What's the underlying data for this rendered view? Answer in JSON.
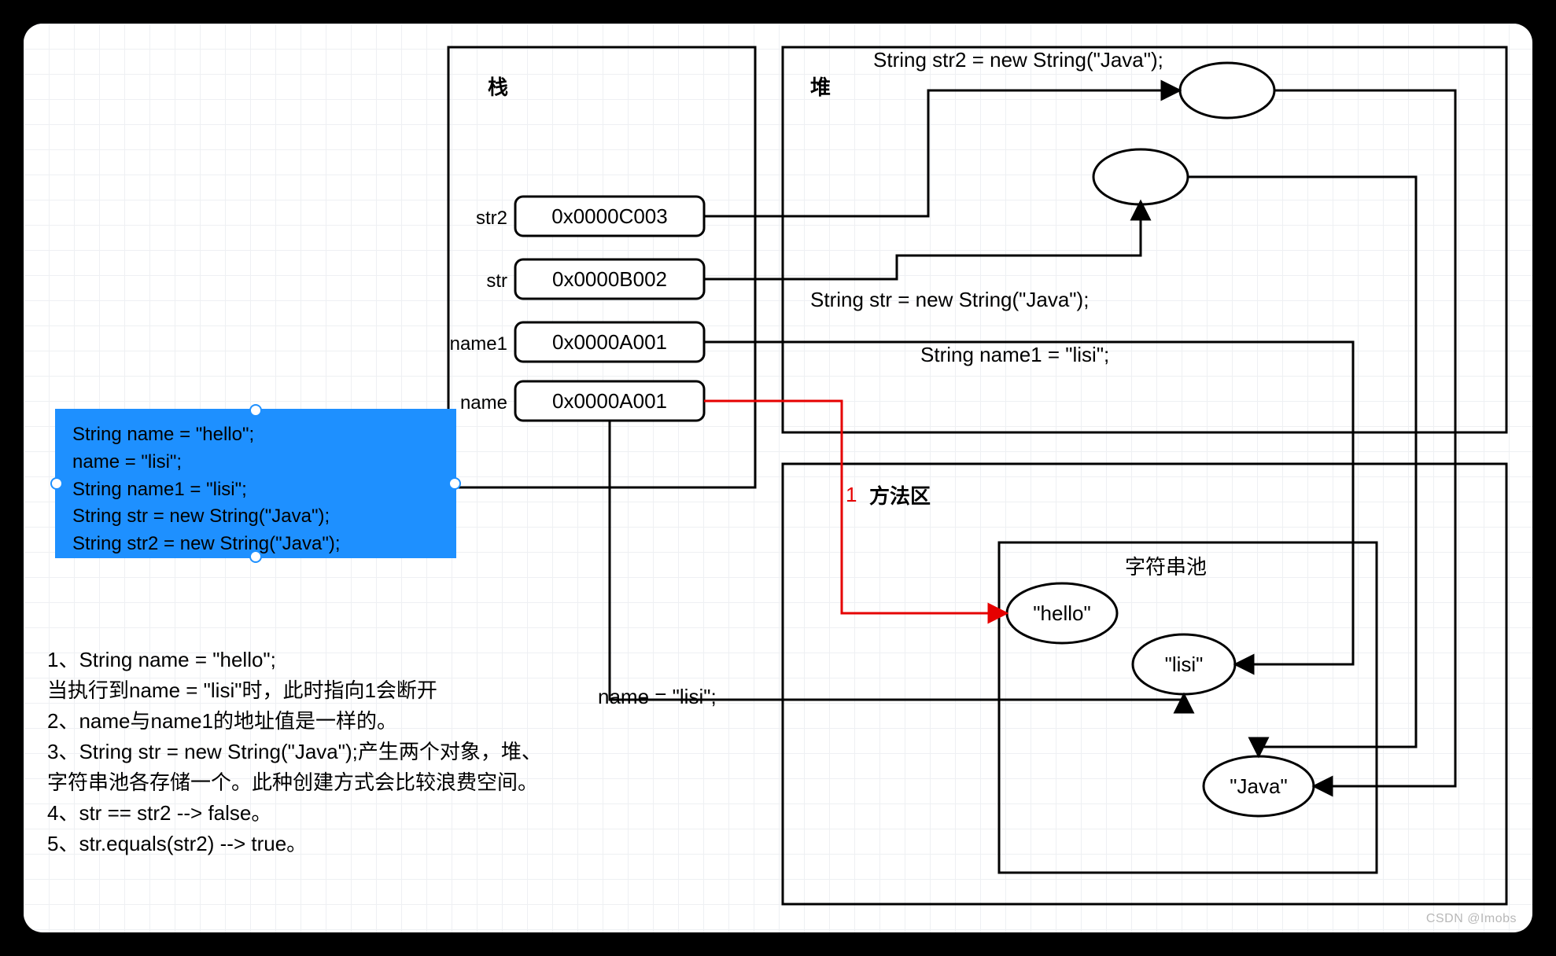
{
  "watermark": "CSDN @Imobs",
  "stack": {
    "title": "栈",
    "vars": [
      {
        "name": "str2",
        "addr": "0x0000C003"
      },
      {
        "name": "str",
        "addr": "0x0000B002"
      },
      {
        "name": "name1",
        "addr": "0x0000A001"
      },
      {
        "name": "name",
        "addr": "0x0000A001"
      }
    ]
  },
  "heap": {
    "title": "堆",
    "annotations": {
      "str2_decl": "String str2 = new String(\"Java\");",
      "str_decl": "String str = new String(\"Java\");",
      "name1_decl": "String name1 = \"lisi\";"
    }
  },
  "method_area": {
    "title": "方法区",
    "pool_title": "字符串池",
    "redline_label": "1",
    "name_assign": "name = \"lisi\";",
    "pool": {
      "hello": "\"hello\"",
      "lisi": "\"lisi\"",
      "java": "\"Java\""
    }
  },
  "code": {
    "l1": "String name = \"hello\";",
    "l2": "name = \"lisi\";",
    "l3": "String name1 = \"lisi\";",
    "l4": "String str = new String(\"Java\");",
    "l5": "String str2 = new String(\"Java\");"
  },
  "notes": {
    "n1": "1、String name = \"hello\";",
    "n1b": "当执行到name = \"lisi\"时，此时指向1会断开",
    "n2": "2、name与name1的地址值是一样的。",
    "n3": "3、String str = new String(\"Java\");产生两个对象，堆、",
    "n3b": "字符串池各存储一个。此种创建方式会比较浪费空间。",
    "n4": "4、str == str2 --> false。",
    "n5": "5、str.equals(str2) --> true。"
  }
}
